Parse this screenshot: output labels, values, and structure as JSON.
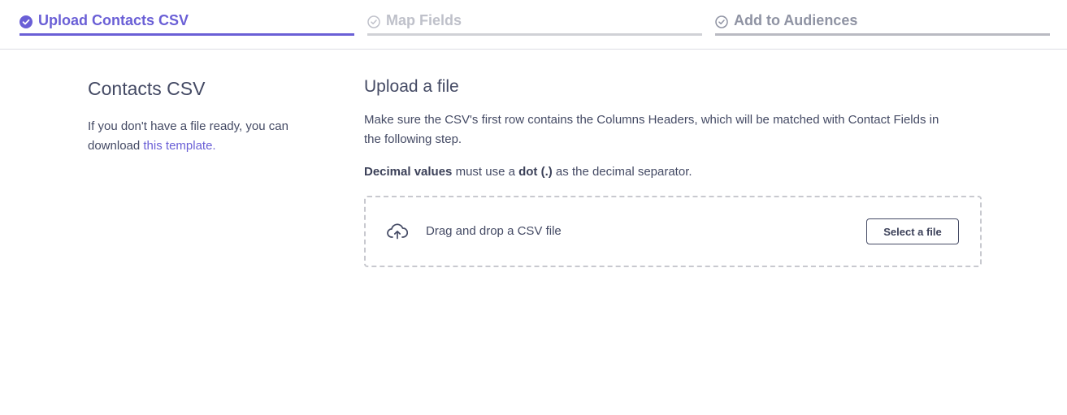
{
  "stepper": {
    "steps": [
      {
        "label": "Upload Contacts CSV",
        "icon": "check-circle-filled-icon",
        "state": "active"
      },
      {
        "label": "Map Fields",
        "icon": "check-circle-outline-icon",
        "state": "disabled"
      },
      {
        "label": "Add to Audiences",
        "icon": "check-circle-outline-icon",
        "state": "inactive"
      }
    ]
  },
  "left": {
    "title": "Contacts CSV",
    "text": "If you don't have a file ready, you can download ",
    "link_label": "this template."
  },
  "upload": {
    "title": "Upload a file",
    "description": "Make sure the CSV's first row contains the Columns Headers, which will be matched with Contact Fields in the following step.",
    "decimal_bold_1": "Decimal values",
    "decimal_text_1": " must use a ",
    "decimal_bold_2": "dot (.)",
    "decimal_text_2": " as the decimal separator.",
    "dropzone_text": "Drag and drop a CSV file",
    "dropzone_icon": "cloud-upload-icon",
    "select_button_label": "Select a file"
  },
  "colors": {
    "accent": "#6a5fd6",
    "text": "#444a64",
    "disabled": "#bfc1ca",
    "border": "#c8c9cf"
  }
}
